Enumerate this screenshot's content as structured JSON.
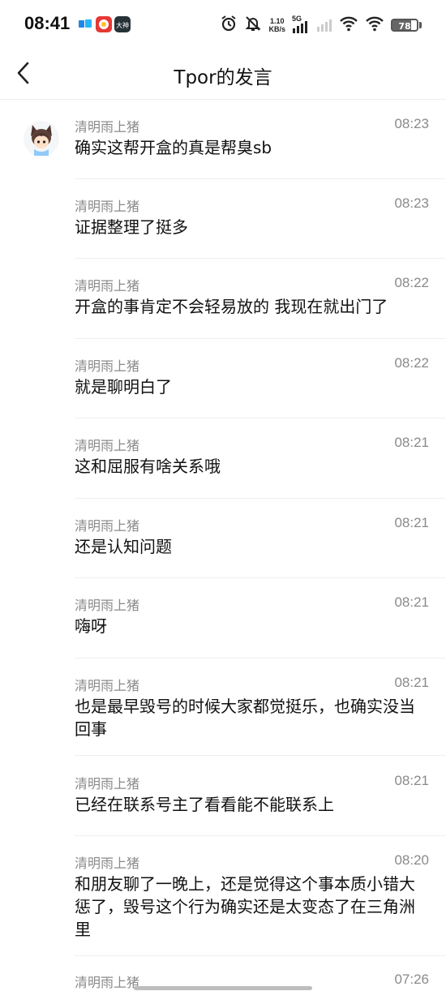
{
  "status_bar": {
    "time": "08:41",
    "net_speed_value": "1.10",
    "net_speed_unit": "KB/s",
    "network_label": "5G",
    "battery": "78",
    "icons": [
      "app-icon-blue",
      "app-icon-game",
      "app-icon-dashen",
      "alarm-icon",
      "mute-bell-icon",
      "signal-icon",
      "wifi-icon",
      "battery-icon"
    ]
  },
  "header": {
    "title": "Tpor的发言"
  },
  "messages": [
    {
      "sender": "清明雨上猪",
      "time": "08:23",
      "text": "确实这帮开盒的真是帮臭sb"
    },
    {
      "sender": "清明雨上猪",
      "time": "08:23",
      "text": "证据整理了挺多"
    },
    {
      "sender": "清明雨上猪",
      "time": "08:22",
      "text": "开盒的事肯定不会轻易放的 我现在就出门了"
    },
    {
      "sender": "清明雨上猪",
      "time": "08:22",
      "text": "就是聊明白了"
    },
    {
      "sender": "清明雨上猪",
      "time": "08:21",
      "text": "这和屈服有啥关系哦"
    },
    {
      "sender": "清明雨上猪",
      "time": "08:21",
      "text": "还是认知问题"
    },
    {
      "sender": "清明雨上猪",
      "time": "08:21",
      "text": "嗨呀"
    },
    {
      "sender": "清明雨上猪",
      "time": "08:21",
      "text": "也是最早毁号的时候大家都觉挺乐，也确实没当回事"
    },
    {
      "sender": "清明雨上猪",
      "time": "08:21",
      "text": "已经在联系号主了看看能不能联系上"
    },
    {
      "sender": "清明雨上猪",
      "time": "08:20",
      "text": "和朋友聊了一晚上，还是觉得这个事本质小错大惩了，毁号这个行为确实还是太变态了在三角洲里"
    },
    {
      "sender": "清明雨上猪",
      "time": "07:26",
      "text": ""
    }
  ],
  "colors": {
    "background": "#ffffff",
    "secondary_text": "#8a8a8a",
    "primary_text": "#111111",
    "divider": "#efefef"
  }
}
